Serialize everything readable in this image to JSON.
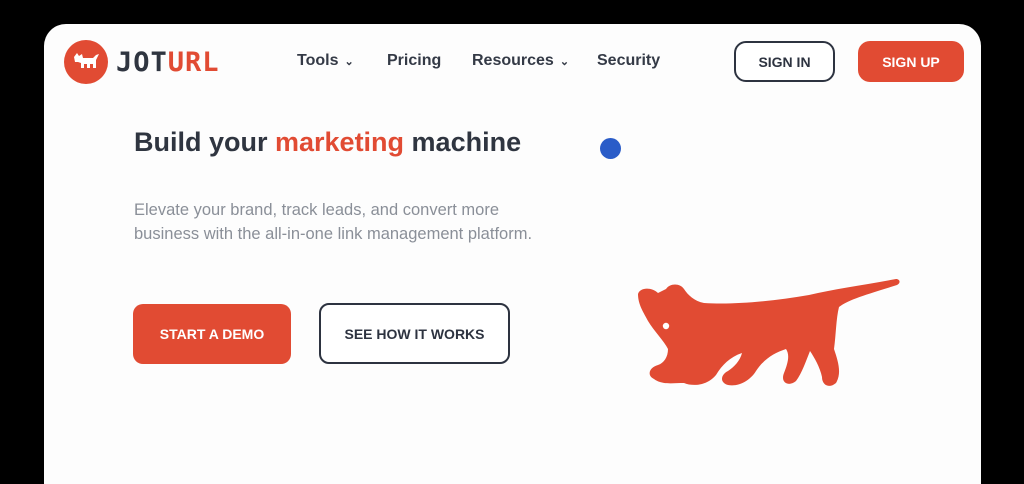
{
  "logo": {
    "text_part1": "JOT",
    "text_part2": "URL",
    "icon": "dog-icon"
  },
  "nav": {
    "items": [
      {
        "label": "Tools",
        "has_dropdown": true
      },
      {
        "label": "Pricing",
        "has_dropdown": false
      },
      {
        "label": "Resources",
        "has_dropdown": true
      },
      {
        "label": "Security",
        "has_dropdown": false
      }
    ],
    "dropdown_icon": "chevron-down-icon"
  },
  "header": {
    "signin_label": "SIGN IN",
    "signup_label": "SIGN UP"
  },
  "hero": {
    "title_prefix": "Build your ",
    "title_accent": "marketing",
    "title_suffix": " machine",
    "description": "Elevate your brand, track leads, and convert more business with the all-in-one link management platform.",
    "demo_button": "START A DEMO",
    "how_button": "SEE HOW IT WORKS"
  },
  "colors": {
    "accent": "#e14b33",
    "text_dark": "#2f3540",
    "text_muted": "#8a8f98",
    "dot_blue": "#2a5cc8"
  }
}
